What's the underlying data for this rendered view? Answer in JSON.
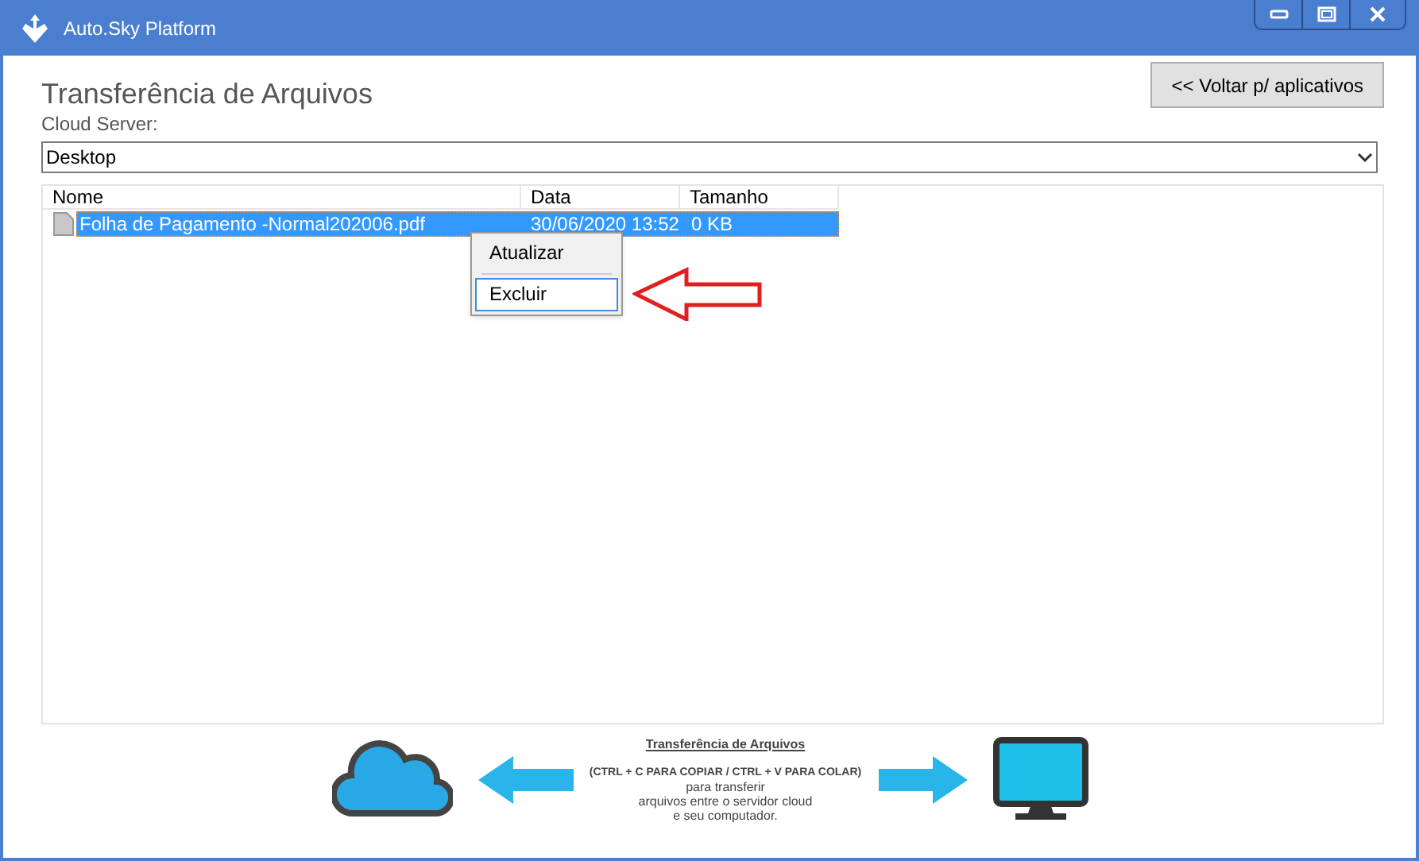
{
  "window": {
    "title": "Auto.Sky Platform"
  },
  "page": {
    "title": "Transferência de Arquivos",
    "back_button": "<< Voltar p/ aplicativos"
  },
  "server": {
    "label": "Cloud Server:",
    "value": "Desktop"
  },
  "table": {
    "columns": [
      "Nome",
      "Data",
      "Tamanho"
    ],
    "rows": [
      {
        "name": "Folha de Pagamento -Normal202006.pdf",
        "date": "30/06/2020 13:52",
        "size": "0 KB",
        "selected": true
      }
    ]
  },
  "context_menu": [
    {
      "label": "Atualizar",
      "selected": false
    },
    {
      "label": "Excluir",
      "selected": true
    }
  ],
  "banner": {
    "title": "Transferência de Arquivos",
    "shortcut": "(CTRL + C PARA COPIAR / CTRL + V PARA COLAR)",
    "lines": [
      "para transferir",
      "arquivos entre o servidor cloud",
      "e seu computador."
    ]
  }
}
